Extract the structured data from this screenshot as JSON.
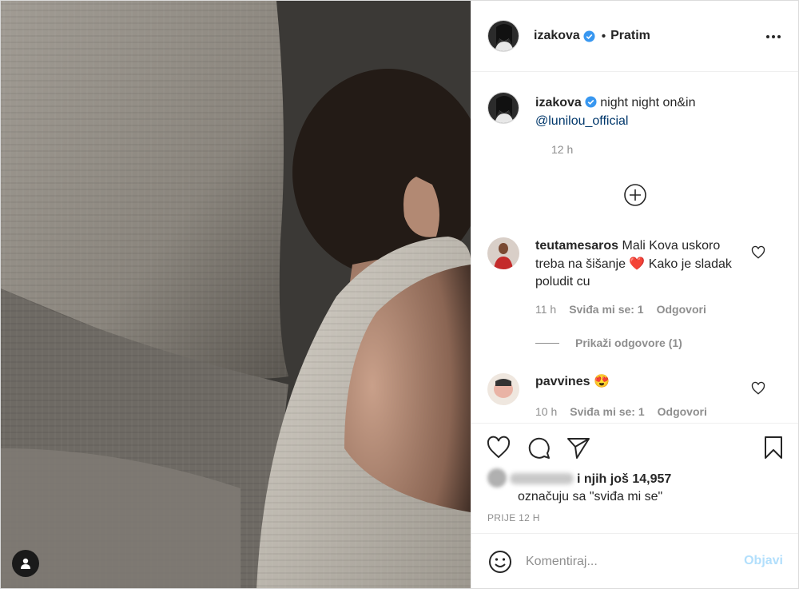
{
  "post": {
    "username": "izakova",
    "follow_sep": "•",
    "follow_label": "Pratim",
    "caption_text": "night night on&in",
    "caption_mention": "@lunilou_official",
    "caption_time": "12 h"
  },
  "comments": [
    {
      "user": "teutamesaros",
      "text_before": "Mali Kova uskoro treba na šišanje",
      "emoji": "❤️",
      "text_after": "Kako je sladak poludit cu",
      "time": "11 h",
      "likes": "Sviđa mi se: 1",
      "reply": "Odgovori",
      "view_replies": "Prikaži odgovore (1)"
    },
    {
      "user": "pavvines",
      "emoji": "😍",
      "time": "10 h",
      "likes": "Sviđa mi se: 1",
      "reply": "Odgovori"
    }
  ],
  "likes": {
    "others": "i njih još 14,957",
    "suffix": "označuju sa \"sviđa mi se\""
  },
  "posted": "PRIJE 12 H",
  "comment_form": {
    "placeholder": "Komentiraj...",
    "submit": "Objavi"
  },
  "icons": [
    "verified-icon",
    "more-icon",
    "add-circle-icon",
    "heart-icon",
    "comment-icon",
    "share-icon",
    "bookmark-icon",
    "emoji-icon",
    "user-tag-icon"
  ],
  "colors": {
    "verified": "#3897f0",
    "link": "#00376b",
    "muted": "#8e8e8e",
    "post_button_disabled": "#b2dffc",
    "heart_emoji": "#e0245e"
  }
}
